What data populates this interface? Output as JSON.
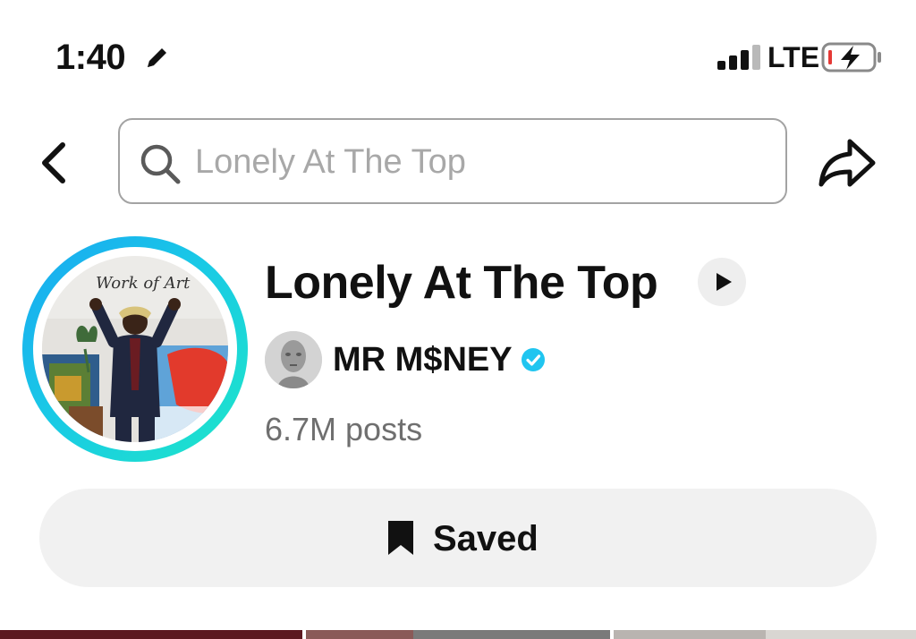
{
  "status_bar": {
    "time": "1:40",
    "network": "LTE",
    "icons": [
      "pencil-icon",
      "cellular-signal-icon",
      "battery-charging-icon"
    ]
  },
  "search": {
    "value": "Lonely At The Top",
    "icons": [
      "back-chevron-icon",
      "search-icon",
      "share-arrow-icon"
    ]
  },
  "sound": {
    "title": "Lonely At The Top",
    "author": "MR M$NEY",
    "verified": true,
    "posts": "6.7M posts",
    "cover_text": "Work of Art"
  },
  "actions": {
    "saved_label": "Saved",
    "saved_icon": "bookmark-icon"
  },
  "colors": {
    "ring_start": "#19a7f2",
    "ring_end": "#1ee6c8",
    "verified": "#20c5f0",
    "saved_bg": "#f1f1f1",
    "placeholder": "#a8a8a8",
    "muted": "#6f6f6f"
  },
  "thumbnails": [
    {
      "color": "#5c1820"
    },
    {
      "color": "#8a5a58"
    },
    {
      "color": "#7a7a7a"
    },
    {
      "color": "#b9b4b0"
    },
    {
      "color": "#d9d6d2"
    }
  ]
}
